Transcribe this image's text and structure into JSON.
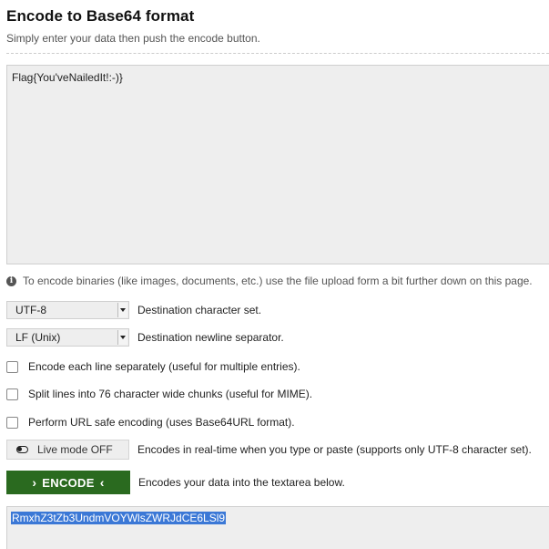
{
  "header": {
    "title": "Encode to Base64 format",
    "subtitle": "Simply enter your data then push the encode button."
  },
  "input": {
    "value": "Flag{You'veNailedIt!:-)}"
  },
  "info": {
    "icon": "info-icon",
    "text": "To encode binaries (like images, documents, etc.) use the file upload form a bit further down on this page."
  },
  "options": {
    "charset": {
      "selected": "UTF-8",
      "description": "Destination character set."
    },
    "newline": {
      "selected": "LF (Unix)",
      "description": "Destination newline separator."
    },
    "encode_each_line": {
      "checked": false,
      "label": "Encode each line separately (useful for multiple entries)."
    },
    "split_lines": {
      "checked": false,
      "label": "Split lines into 76 character wide chunks (useful for MIME)."
    },
    "url_safe": {
      "checked": false,
      "label": "Perform URL safe encoding (uses Base64URL format)."
    },
    "live_mode": {
      "label": "Live mode OFF",
      "icon": "toggle-off-icon",
      "description": "Encodes in real-time when you type or paste (supports only UTF-8 character set)."
    }
  },
  "encode": {
    "label": "ENCODE",
    "description": "Encodes your data into the textarea below.",
    "color": "#2a6a1f"
  },
  "output": {
    "value": "RmxhZ3tZb3UndmVOYWlsZWRJdCE6LSl9"
  }
}
